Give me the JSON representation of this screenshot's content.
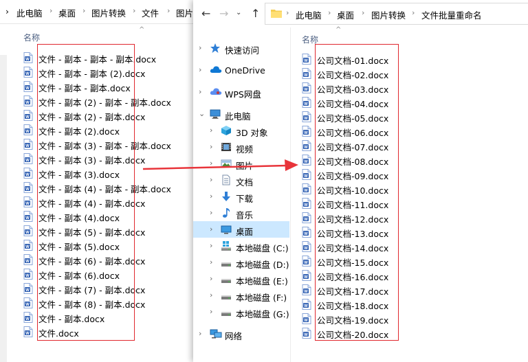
{
  "left_window": {
    "breadcrumb": [
      "此电脑",
      "桌面",
      "图片转换",
      "文件",
      "图片"
    ],
    "column_header": "名称",
    "sort_glyph": "^",
    "files": [
      "文件 - 副本 - 副本 - 副本.docx",
      "文件 - 副本 - 副本 (2).docx",
      "文件 - 副本 - 副本.docx",
      "文件 - 副本 (2) - 副本 - 副本.docx",
      "文件 - 副本 (2) - 副本.docx",
      "文件 - 副本 (2).docx",
      "文件 - 副本 (3) - 副本 - 副本.docx",
      "文件 - 副本 (3) - 副本.docx",
      "文件 - 副本 (3).docx",
      "文件 - 副本 (4) - 副本 - 副本.docx",
      "文件 - 副本 (4) - 副本.docx",
      "文件 - 副本 (4).docx",
      "文件 - 副本 (5) - 副本.docx",
      "文件 - 副本 (5).docx",
      "文件 - 副本 (6) - 副本.docx",
      "文件 - 副本 (6).docx",
      "文件 - 副本 (7) - 副本.docx",
      "文件 - 副本 (8) - 副本.docx",
      "文件 - 副本.docx",
      "文件.docx"
    ]
  },
  "right_window": {
    "breadcrumb": [
      "此电脑",
      "桌面",
      "图片转换",
      "文件批量重命名"
    ],
    "column_header": "名称",
    "sort_glyph": "^",
    "nav": [
      {
        "label": "快速访问",
        "icon": "star-icon"
      },
      {
        "label": "OneDrive",
        "icon": "cloud-icon"
      },
      {
        "label": "WPS网盘",
        "icon": "wps-cloud-icon"
      },
      {
        "label": "此电脑",
        "icon": "computer-icon"
      },
      {
        "label": "3D 对象",
        "icon": "cube-icon"
      },
      {
        "label": "视频",
        "icon": "video-icon"
      },
      {
        "label": "图片",
        "icon": "picture-icon"
      },
      {
        "label": "文档",
        "icon": "document-icon"
      },
      {
        "label": "下载",
        "icon": "download-icon"
      },
      {
        "label": "音乐",
        "icon": "music-icon"
      },
      {
        "label": "桌面",
        "icon": "desktop-icon"
      },
      {
        "label": "本地磁盘 (C:)",
        "icon": "windows-drive-icon"
      },
      {
        "label": "本地磁盘 (D:)",
        "icon": "drive-icon"
      },
      {
        "label": "本地磁盘 (E:)",
        "icon": "drive-icon"
      },
      {
        "label": "本地磁盘 (F:)",
        "icon": "drive-icon"
      },
      {
        "label": "本地磁盘 (G:)",
        "icon": "drive-icon"
      },
      {
        "label": "网络",
        "icon": "network-icon"
      }
    ],
    "selected_nav": "桌面",
    "files": [
      "公司文档-01.docx",
      "公司文档-02.docx",
      "公司文档-03.docx",
      "公司文档-04.docx",
      "公司文档-05.docx",
      "公司文档-06.docx",
      "公司文档-07.docx",
      "公司文档-08.docx",
      "公司文档-09.docx",
      "公司文档-10.docx",
      "公司文档-11.docx",
      "公司文档-12.docx",
      "公司文档-13.docx",
      "公司文档-14.docx",
      "公司文档-15.docx",
      "公司文档-16.docx",
      "公司文档-17.docx",
      "公司文档-18.docx",
      "公司文档-19.docx",
      "公司文档-20.docx"
    ]
  },
  "colors": {
    "highlight_box": "#e0262d",
    "arrow": "#e8343a",
    "selection": "#cce8ff",
    "word_icon_blue": "#2b5cb0"
  }
}
